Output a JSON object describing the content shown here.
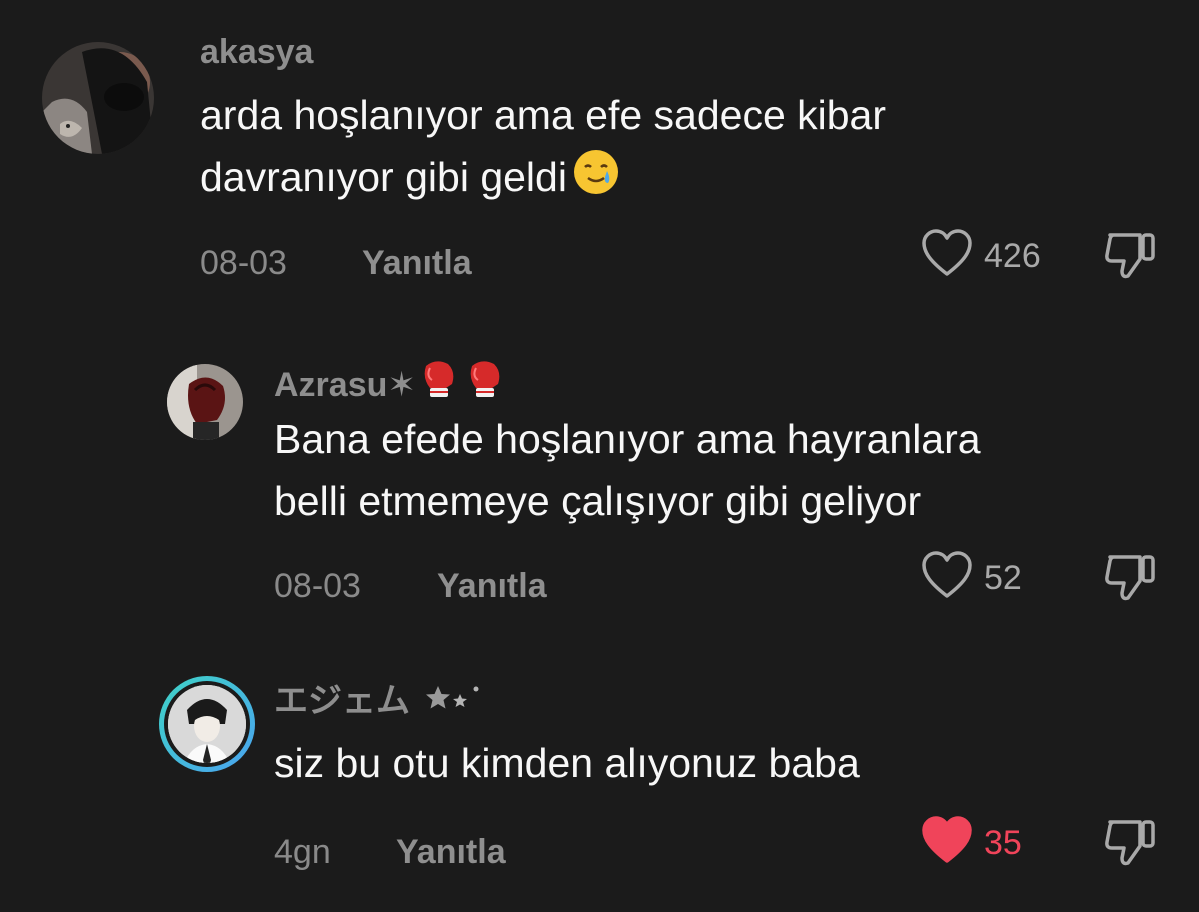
{
  "comments": [
    {
      "username": "akasya",
      "text_line1": "arda hoşlanıyor ama efe sadece kibar",
      "text_line2": "davranıyor gibi geldi",
      "emoji": "crying-smile-emoji",
      "date": "08-03",
      "reply_label": "Yanıtla",
      "like_count": "426",
      "liked": false
    },
    {
      "username": "Azrasu✶",
      "username_emoji": "boxing-gloves-emoji",
      "text_line1": "Bana efede hoşlanıyor ama hayranlara",
      "text_line2": "belli etmemeye çalışıyor gibi geliyor",
      "date": "08-03",
      "reply_label": "Yanıtla",
      "like_count": "52",
      "liked": false
    },
    {
      "username": "エジェム",
      "username_badge": "stars-icon",
      "text_line1": "siz bu otu kimden alıyonuz baba",
      "date": "4gn",
      "reply_label": "Yanıtla",
      "like_count": "35",
      "liked": true
    }
  ],
  "colors": {
    "background": "#1b1b1b",
    "liked": "#f0445a",
    "story_ring_start": "#3fd3c6",
    "story_ring_end": "#4aa3f0"
  }
}
